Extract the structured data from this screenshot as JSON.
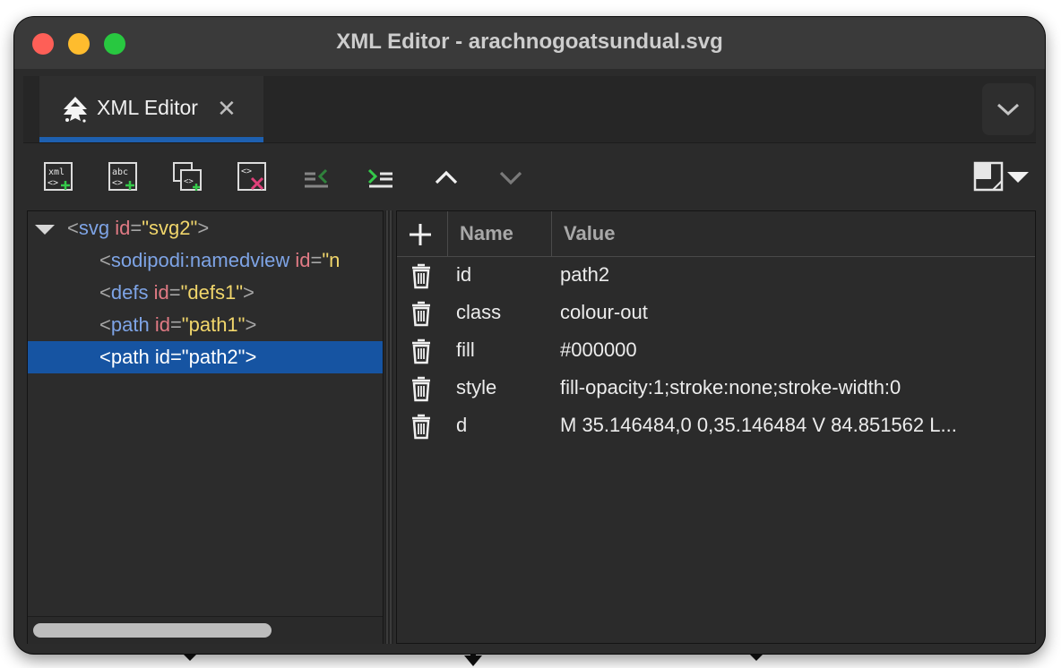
{
  "window": {
    "title": "XML Editor - arachnogoatsundual.svg"
  },
  "tab": {
    "label": "XML Editor",
    "close_glyph": "✕",
    "icon": "inkscape-logo-icon"
  },
  "toolbar": {
    "buttons": [
      {
        "name": "new-element-node-button",
        "icon": "xml-plus-icon",
        "glyph": "xml"
      },
      {
        "name": "new-text-node-button",
        "icon": "abc-plus-icon",
        "glyph": "abc"
      },
      {
        "name": "duplicate-node-button",
        "icon": "duplicate-node-icon"
      },
      {
        "name": "delete-node-button",
        "icon": "delete-node-icon"
      },
      {
        "name": "unindent-node-button",
        "icon": "unindent-icon"
      },
      {
        "name": "indent-node-button",
        "icon": "indent-icon"
      },
      {
        "name": "raise-node-button",
        "icon": "chevron-up-icon"
      },
      {
        "name": "lower-node-button",
        "icon": "chevron-down-icon"
      }
    ]
  },
  "tree": {
    "nodes": [
      {
        "tag": "svg",
        "attr": "id",
        "value": "\"svg2\"",
        "expanded": true,
        "selected": false
      },
      {
        "tag": "sodipodi:namedview",
        "attr": "id",
        "value": "\"n",
        "selected": false
      },
      {
        "tag": "defs",
        "attr": "id",
        "value": "\"defs1\"",
        "selected": false
      },
      {
        "tag": "path",
        "attr": "id",
        "value": "\"path1\"",
        "selected": false
      },
      {
        "tag": "path",
        "attr": "id",
        "value": "\"path2\"",
        "selected": true
      }
    ],
    "open_bracket": "<",
    "close_bracket": ">",
    "equals": "="
  },
  "attributes": {
    "header": {
      "name": "Name",
      "value": "Value"
    },
    "rows": [
      {
        "name": "id",
        "value": "path2"
      },
      {
        "name": "class",
        "value": "colour-out"
      },
      {
        "name": "fill",
        "value": "#000000"
      },
      {
        "name": "style",
        "value": "fill-opacity:1;stroke:none;stroke-width:0"
      },
      {
        "name": "d",
        "value": "M 35.146484,0 0,35.146484 V 84.851562 L..."
      }
    ]
  },
  "colors": {
    "selection": "#1654a2",
    "accent_tab": "#1e60b0",
    "tag": "#7ea4e6",
    "attribute": "#e07a84",
    "value": "#f1d66b",
    "add_green": "#35c94a",
    "delete_pink": "#e0407a"
  }
}
